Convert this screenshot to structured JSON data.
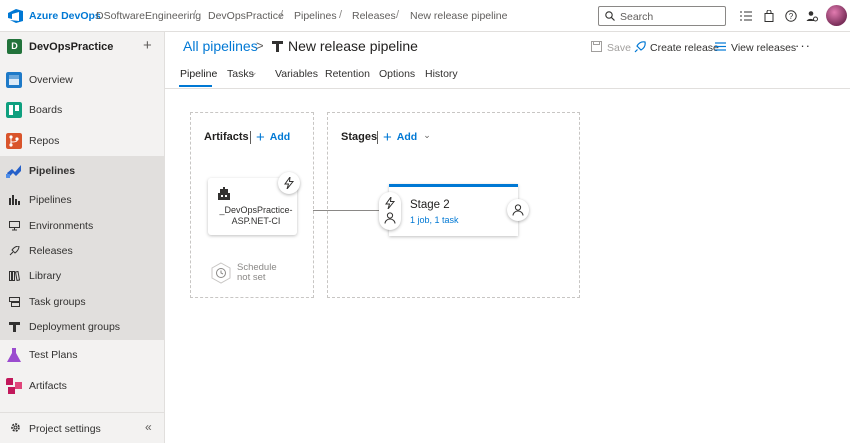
{
  "topbar": {
    "brand": "Azure DevOps",
    "breadcrumbs": [
      "DSoftwareEngineering",
      "DevOpsPractice",
      "Pipelines",
      "Releases",
      "New release pipeline"
    ],
    "separator": "/",
    "search_placeholder": "Search"
  },
  "sidebar": {
    "project_initial": "D",
    "project_name": "DevOpsPractice",
    "add_symbol": "+",
    "items": [
      {
        "label": "Overview",
        "color": "#1e7ac8"
      },
      {
        "label": "Boards",
        "color": "#0fa07f"
      },
      {
        "label": "Repos",
        "color": "#d9542b"
      },
      {
        "label": "Pipelines",
        "color": "#2560c9"
      }
    ],
    "pipeline_sub": [
      "Pipelines",
      "Environments",
      "Releases",
      "Library",
      "Task groups",
      "Deployment groups"
    ],
    "items_after": [
      {
        "label": "Test Plans",
        "color": "#9b4ccf"
      },
      {
        "label": "Artifacts",
        "color": "#c2185b"
      }
    ],
    "footer_label": "Project settings",
    "collapse_symbol": "«"
  },
  "header": {
    "all_pipelines": "All pipelines",
    "chevron": ">",
    "title": "New release pipeline",
    "save_label": "Save",
    "create_release_label": "Create release",
    "view_releases_label": "View releases",
    "more_symbol": "···"
  },
  "tabs": [
    "Pipeline",
    "Tasks",
    "Variables",
    "Retention",
    "Options",
    "History"
  ],
  "tasks_chevron": "⌄",
  "artifacts_panel": {
    "title": "Artifacts",
    "add_label": "Add",
    "artifact_name": "_DevOpsPractice-ASP.NET-CI",
    "schedule_line1": "Schedule",
    "schedule_line2": "not set"
  },
  "stages_panel": {
    "title": "Stages",
    "add_label": "Add",
    "add_chevron": "⌄",
    "stage_name": "Stage 2",
    "stage_summary": "1 job, 1 task"
  },
  "colors": {
    "accent": "#0078d4",
    "project_badge": "#22733b"
  }
}
